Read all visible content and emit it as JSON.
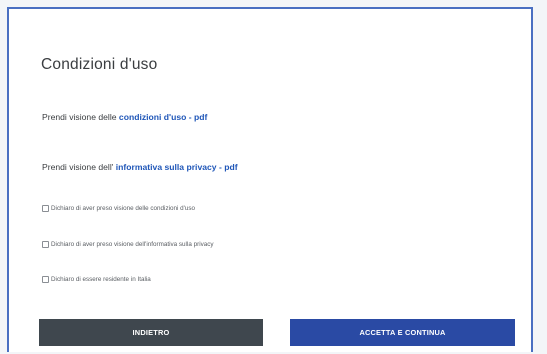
{
  "dialog": {
    "title": "Condizioni d'uso"
  },
  "documents": [
    {
      "prefix": "Prendi visione delle ",
      "link": "condizioni d'uso - pdf"
    },
    {
      "prefix": "Prendi visione dell' ",
      "link": "informativa sulla privacy - pdf"
    }
  ],
  "checkboxes": [
    {
      "label": "Dichiaro di aver preso visione delle condizioni d'uso",
      "checked": false
    },
    {
      "label": "Dichiaro di aver preso visione dell'informativa sulla privacy",
      "checked": false
    },
    {
      "label": "Dichiaro di essere residente in Italia",
      "checked": false
    }
  ],
  "buttons": {
    "back_label": "INDIETRO",
    "accept_label": "ACCETTA E CONTINUA"
  },
  "colors": {
    "accent": "#4a6fc2",
    "link": "#1f56b8",
    "back_button": "#3f474e",
    "accept_button": "#2a4aa4"
  }
}
